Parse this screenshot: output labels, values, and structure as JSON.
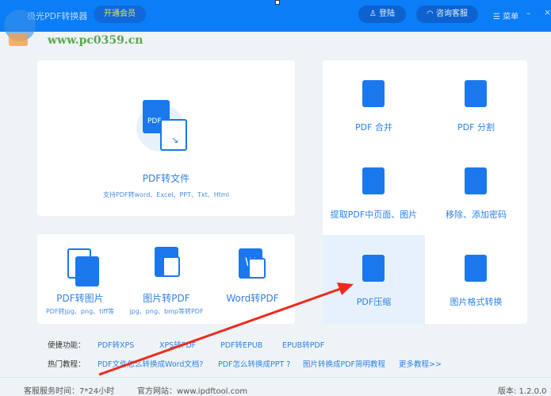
{
  "header": {
    "title": "极光PDF转换器",
    "vip_label": "开通会员",
    "login_label": "登陆",
    "support_label": "咨询客服",
    "menu_label": "菜单",
    "minimize": "–",
    "close": "×"
  },
  "watermark": "www.pc0359.cn",
  "main_card": {
    "title": "PDF转文件",
    "subtitle": "支持PDF转word、Excel、PPT、Txt、Html"
  },
  "tools": [
    {
      "title": "PDF转图片",
      "subtitle": "PDF转jpg、png、tiff等"
    },
    {
      "title": "图片转PDF",
      "subtitle": "jpg、png、bmp等转PDF"
    },
    {
      "title": "Word转PDF",
      "subtitle": ""
    }
  ],
  "grid": [
    {
      "label": "PDF 合并"
    },
    {
      "label": "PDF 分割"
    },
    {
      "label": "提取PDF中页面、图片"
    },
    {
      "label": "移除、添加密码"
    },
    {
      "label": "PDF压缩"
    },
    {
      "label": "图片格式转换"
    }
  ],
  "quick": {
    "label": "便捷功能：",
    "links": [
      "PDF转XPS",
      "XPS转PDF",
      "PDF转EPUB",
      "EPUB转PDF"
    ]
  },
  "tutorials": {
    "label": "热门教程：",
    "links": [
      "PDF文件怎么转换成Word文档?",
      "PDF怎么转换成PPT ?",
      "图片转换成PDF简明教程",
      "更多教程>>"
    ]
  },
  "footer": {
    "service": "客服服务时间：7*24小时",
    "website": "官方网站：www.ipdftool.com",
    "version": "版本: 1.2.0.0"
  },
  "colors": {
    "header": "#0a7df7",
    "accent": "#2e82e6",
    "highlight": "#e6f1fc",
    "arrow": "#ee2a1f"
  }
}
